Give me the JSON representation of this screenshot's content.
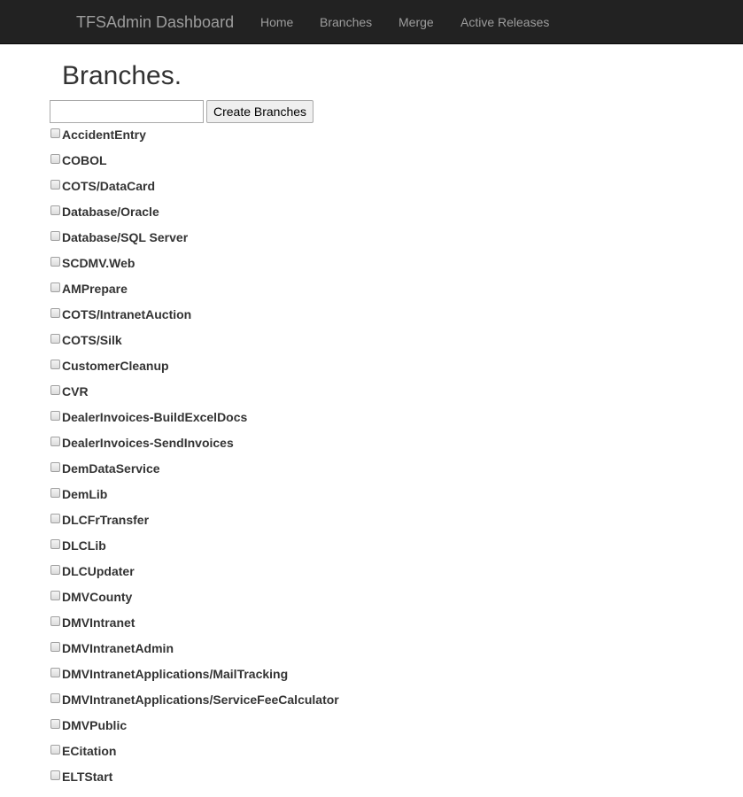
{
  "navbar": {
    "brand": "TFSAdmin Dashboard",
    "links": [
      "Home",
      "Branches",
      "Merge",
      "Active Releases"
    ]
  },
  "page": {
    "title": "Branches."
  },
  "create_form": {
    "input_value": "",
    "button_label": "Create Branches"
  },
  "branches": [
    "AccidentEntry",
    "COBOL",
    "COTS/DataCard",
    "Database/Oracle",
    "Database/SQL Server",
    "SCDMV.Web",
    "AMPrepare",
    "COTS/IntranetAuction",
    "COTS/Silk",
    "CustomerCleanup",
    "CVR",
    "DealerInvoices-BuildExcelDocs",
    "DealerInvoices-SendInvoices",
    "DemDataService",
    "DemLib",
    "DLCFrTransfer",
    "DLCLib",
    "DLCUpdater",
    "DMVCounty",
    "DMVIntranet",
    "DMVIntranetAdmin",
    "DMVIntranetApplications/MailTracking",
    "DMVIntranetApplications/ServiceFeeCalculator",
    "DMVPublic",
    "ECitation",
    "ELTStart"
  ],
  "checkbox_states": [
    false,
    false,
    false,
    false,
    false,
    false,
    false,
    false,
    false,
    false,
    false,
    false,
    false,
    false,
    false,
    false,
    false,
    false,
    false,
    false,
    false,
    false,
    false,
    false,
    false,
    false
  ]
}
